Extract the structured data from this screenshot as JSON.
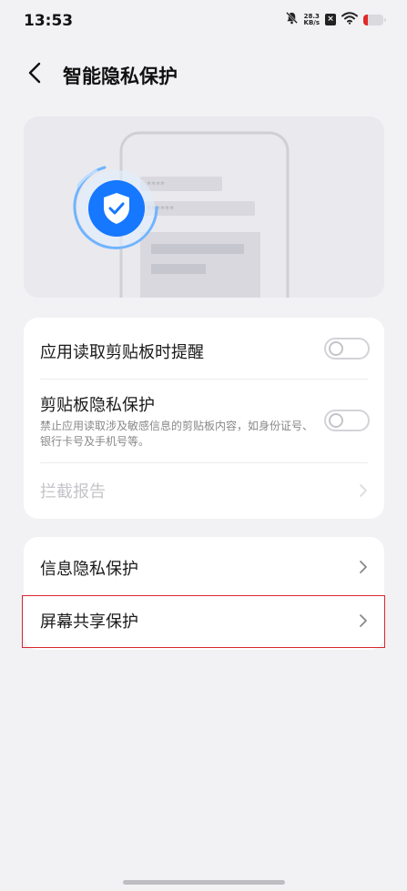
{
  "status_bar": {
    "time": "13:53",
    "net_speed_value": "28.3",
    "net_speed_unit": "KB/s",
    "icons": [
      "bell-muted-icon",
      "sim-disabled-icon",
      "wifi-icon",
      "battery-icon"
    ],
    "battery_color": "#e02a2a"
  },
  "header": {
    "title": "智能隐私保护",
    "back_icon": "back-arrow-icon"
  },
  "illustration": {
    "icon": "shield-check-icon",
    "accent_color": "#1677ff",
    "masked_fields": [
      "****",
      "******"
    ]
  },
  "card1": {
    "items": [
      {
        "title": "应用读取剪贴板时提醒",
        "toggle_on": false
      },
      {
        "title": "剪贴板隐私保护",
        "subtitle": "禁止应用读取涉及敏感信息的剪贴板内容，如身份证号、银行卡号及手机号等。",
        "toggle_on": false
      },
      {
        "title": "拦截报告",
        "disabled": true
      }
    ]
  },
  "card2": {
    "items": [
      {
        "title": "信息隐私保护"
      },
      {
        "title": "屏幕共享保护",
        "highlighted": true
      }
    ]
  },
  "highlight_color": "#d9262e"
}
